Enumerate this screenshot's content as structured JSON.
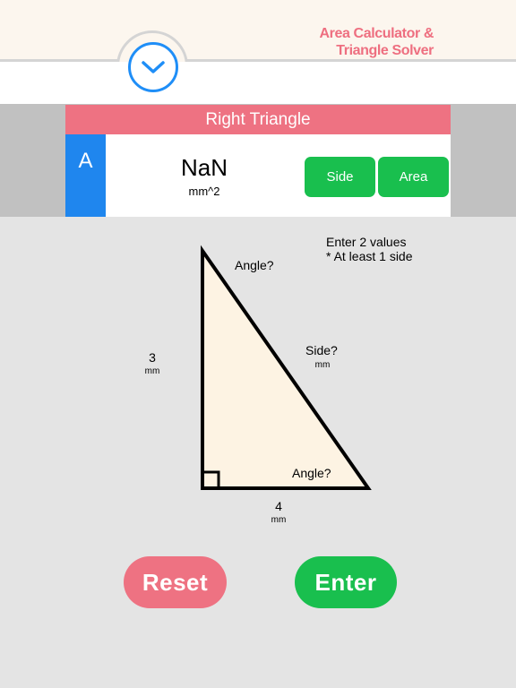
{
  "header": {
    "title_line1": "Area Calculator &",
    "title_line2": "Triangle Solver",
    "toggle_icon": "chevron-down-icon"
  },
  "result": {
    "shape_title": "Right Triangle",
    "variable": "A",
    "value": "NaN",
    "unit": "mm^2",
    "mode_buttons": [
      "Side",
      "Area"
    ]
  },
  "instructions": {
    "line1": "Enter 2 values",
    "line2": "* At least 1 side"
  },
  "triangle": {
    "left_side": {
      "value": "3",
      "unit": "mm"
    },
    "bottom_side": {
      "value": "4",
      "unit": "mm"
    },
    "hypotenuse": {
      "value": "Side?",
      "unit": "mm"
    },
    "top_angle": "Angle?",
    "bottom_angle": "Angle?"
  },
  "actions": {
    "reset": "Reset",
    "enter": "Enter"
  },
  "colors": {
    "accent_blue": "#1f86ee",
    "pink": "#ee7282",
    "green": "#19bf4e",
    "triangle_fill": "#fdf3e3"
  }
}
